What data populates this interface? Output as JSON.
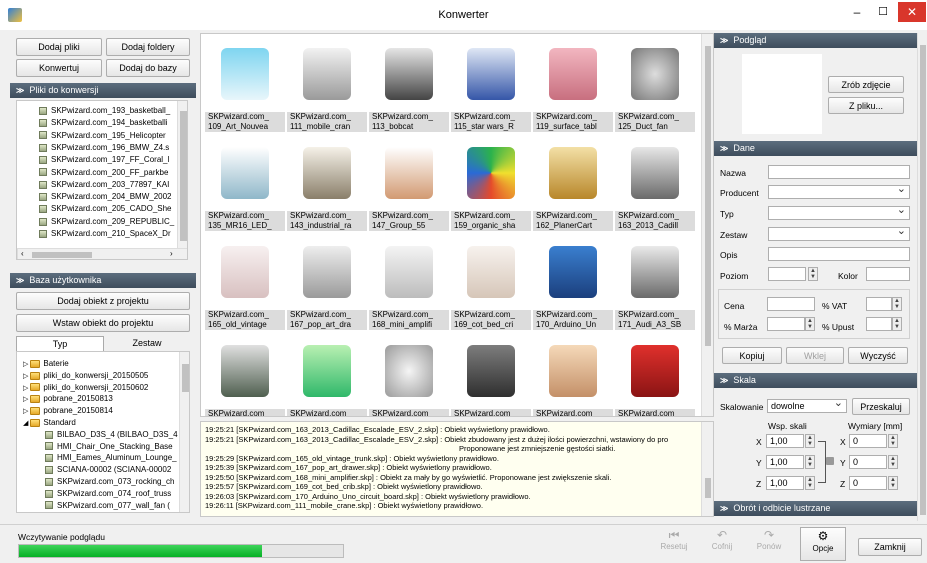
{
  "window": {
    "title": "Konwerter"
  },
  "left_buttons": {
    "add_files": "Dodaj pliki",
    "add_folders": "Dodaj foldery",
    "convert": "Konwertuj",
    "add_to_db": "Dodaj do bazy"
  },
  "files_section": {
    "title": "Pliki do konwersji",
    "items": [
      "SKPwizard.com_193_basketball_",
      "SKPwizard.com_194_basketballi",
      "SKPwizard.com_195_Helicopter",
      "SKPwizard.com_196_BMW_Z4.s",
      "SKPwizard.com_197_FF_Coral_l",
      "SKPwizard.com_200_FF_parkbe",
      "SKPwizard.com_203_77897_KAI",
      "SKPwizard.com_204_BMW_2002",
      "SKPwizard.com_205_CADO_She",
      "SKPwizard.com_209_REPUBLIC_",
      "SKPwizard.com_210_SpaceX_Dr"
    ]
  },
  "user_db": {
    "title": "Baza użytkownika",
    "add_object": "Dodaj obiekt z projektu",
    "insert_object": "Wstaw obiekt do projektu",
    "tab_type": "Typ",
    "tab_set": "Zestaw",
    "tree": [
      {
        "label": "Baterie",
        "kind": "folder",
        "indent": 0
      },
      {
        "label": "pliki_do_konwersji_20150505",
        "kind": "folder",
        "indent": 0
      },
      {
        "label": "pliki_do_konwersji_20150602",
        "kind": "folder",
        "indent": 0
      },
      {
        "label": "pobrane_20150813",
        "kind": "folder",
        "indent": 0
      },
      {
        "label": "pobrane_20150814",
        "kind": "folder",
        "indent": 0
      },
      {
        "label": "Standard",
        "kind": "open",
        "indent": 0
      },
      {
        "label": "BILBAO_D3S_4 (BILBAO_D3S_4",
        "kind": "file",
        "indent": 1
      },
      {
        "label": "HMI_Chair_One_Stacking_Base",
        "kind": "file",
        "indent": 1
      },
      {
        "label": "HMI_Eames_Aluminum_Lounge_",
        "kind": "file",
        "indent": 1
      },
      {
        "label": "SCIANA-00002 (SCIANA-00002",
        "kind": "file",
        "indent": 1
      },
      {
        "label": "SKPwizard.com_073_rocking_ch",
        "kind": "file",
        "indent": 1
      },
      {
        "label": "SKPwizard.com_074_roof_truss",
        "kind": "file",
        "indent": 1
      },
      {
        "label": "SKPwizard.com_077_wall_fan (",
        "kind": "file",
        "indent": 1
      }
    ]
  },
  "thumbnails": [
    {
      "cap1": "SKPwizard.com_",
      "cap2": "109_Art_Nouvea",
      "icon": "stained-glass-window"
    },
    {
      "cap1": "SKPwizard.com_",
      "cap2": "111_mobile_cran",
      "icon": "mobile-crane"
    },
    {
      "cap1": "SKPwizard.com_",
      "cap2": "113_bobcat",
      "icon": "bobcat"
    },
    {
      "cap1": "SKPwizard.com_",
      "cap2": "115_star wars_R",
      "icon": "r2d2"
    },
    {
      "cap1": "SKPwizard.com_",
      "cap2": "119_surface_tabl",
      "icon": "surface-tablet"
    },
    {
      "cap1": "SKPwizard.com_",
      "cap2": "125_Duct_fan",
      "icon": "duct-fan"
    },
    {
      "cap1": "SKPwizard.com_",
      "cap2": "135_MR16_LED_",
      "icon": "lamp"
    },
    {
      "cap1": "SKPwizard.com_",
      "cap2": "143_industrial_ra",
      "icon": "industrial-rack"
    },
    {
      "cap1": "SKPwizard.com_",
      "cap2": "147_Group_55",
      "icon": "stairs"
    },
    {
      "cap1": "SKPwizard.com_",
      "cap2": "159_organic_sha",
      "icon": "organic-shape"
    },
    {
      "cap1": "SKPwizard.com_",
      "cap2": "162_PlanerCart",
      "icon": "planer-cart"
    },
    {
      "cap1": "SKPwizard.com_",
      "cap2": "163_2013_Cadill",
      "icon": "cadillac"
    },
    {
      "cap1": "SKPwizard.com_",
      "cap2": "165_old_vintage",
      "icon": "vintage-trunk"
    },
    {
      "cap1": "SKPwizard.com_",
      "cap2": "167_pop_art_dra",
      "icon": "drawer"
    },
    {
      "cap1": "SKPwizard.com_",
      "cap2": "168_mini_amplifi",
      "icon": "amplifier"
    },
    {
      "cap1": "SKPwizard.com_",
      "cap2": "169_cot_bed_cri",
      "icon": "crib"
    },
    {
      "cap1": "SKPwizard.com_",
      "cap2": "170_Arduino_Un",
      "icon": "arduino"
    },
    {
      "cap1": "SKPwizard.com_",
      "cap2": "171_Audi_A3_SB",
      "icon": "audi"
    },
    {
      "cap1": "SKPwizard.com",
      "cap2": "",
      "icon": "gems"
    },
    {
      "cap1": "SKPwizard.com",
      "cap2": "",
      "icon": "green-objects"
    },
    {
      "cap1": "SKPwizard.com",
      "cap2": "",
      "icon": "sphere"
    },
    {
      "cap1": "SKPwizard.com",
      "cap2": "",
      "icon": "cabinet"
    },
    {
      "cap1": "SKPwizard.com",
      "cap2": "",
      "icon": "dresser"
    },
    {
      "cap1": "SKPwizard.com",
      "cap2": "",
      "icon": "phone-booth"
    }
  ],
  "log": [
    "19:25:21 [SKPwizard.com_163_2013_Cadillac_Escalade_ESV_2.skp] : Obiekt wyświetlony prawidłowo.",
    "19:25:21 [SKPwizard.com_163_2013_Cadillac_Escalade_ESV_2.skp] : Obiekt zbudowany jest z dużej ilości powierzchni, wstawiony do pro",
    "Proponowane jest zmniejszenie gęstości siatki.",
    "19:25:29 [SKPwizard.com_165_old_vintage_trunk.skp] : Obiekt wyświetlony prawidłowo.",
    "19:25:39 [SKPwizard.com_167_pop_art_drawer.skp] : Obiekt wyświetlony prawidłowo.",
    "19:25:50 [SKPwizard.com_168_mini_amplifier.skp] : Obiekt za mały by go wyświetlić. Proponowane jest zwiększenie skali.",
    "19:25:57 [SKPwizard.com_169_cot_bed_crib.skp] : Obiekt wyświetlony prawidłowo.",
    "19:26:03 [SKPwizard.com_170_Arduino_Uno_circuit_board.skp] : Obiekt wyświetlony prawidłowo.",
    "19:26:11 [SKPwizard.com_111_mobile_crane.skp] : Obiekt wyświetlony prawidłowo."
  ],
  "preview": {
    "title": "Podgląd",
    "screenshot": "Zrób zdjęcie",
    "from_file": "Z pliku..."
  },
  "data": {
    "title": "Dane",
    "name": "Nazwa",
    "producer": "Producent",
    "type": "Typ",
    "set": "Zestaw",
    "desc": "Opis",
    "level": "Poziom",
    "color": "Kolor",
    "price": "Cena",
    "vat": "% VAT",
    "margin": "% Marża",
    "discount": "% Upust",
    "copy": "Kopiuj",
    "paste": "Wklej",
    "clear": "Wyczyść"
  },
  "scale": {
    "title": "Skala",
    "scaling": "Skalowanie",
    "scaling_value": "dowolne",
    "rescale": "Przeskaluj",
    "scale_factor": "Wsp. skali",
    "dims": "Wymiary [mm]",
    "x": "1,00",
    "y": "1,00",
    "z": "1,00",
    "dx": "0",
    "dy": "0",
    "dz": "0"
  },
  "rotate": {
    "title": "Obrót i odbicie lustrzane"
  },
  "status": {
    "loading": "Wczytywanie podglądu",
    "progress": 0.75
  },
  "bottom": {
    "reset": "Resetuj",
    "undo": "Cofnij",
    "redo": "Ponów",
    "options": "Opcje",
    "close": "Zamknij"
  },
  "colors": {
    "accent": "#d9362b",
    "progress": "#06b025",
    "header": "#4a5968"
  }
}
